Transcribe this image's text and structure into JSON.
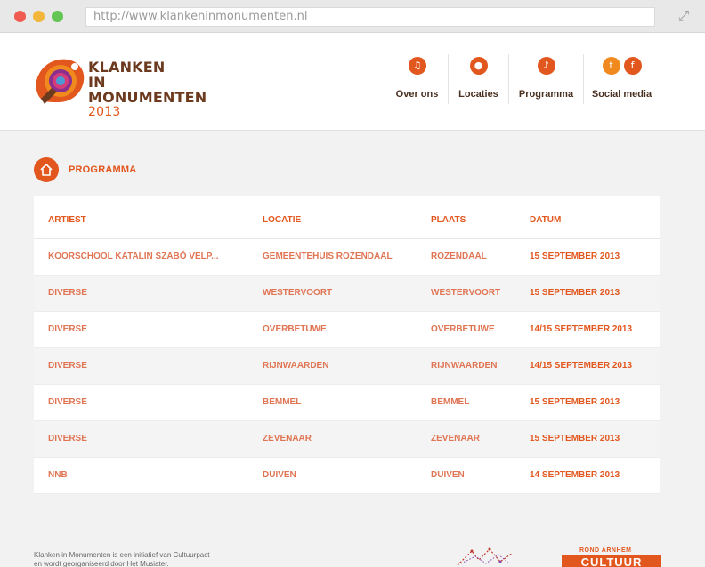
{
  "browser": {
    "url": "http://www.klankeninmonumenten.nl"
  },
  "logo": {
    "line1": "KLANKEN",
    "line2": "IN MONUMENTEN",
    "year": "2013"
  },
  "nav": {
    "items": [
      {
        "label": "Over ons",
        "icon": "music-note-icon"
      },
      {
        "label": "Locaties",
        "icon": "map-pin-icon"
      },
      {
        "label": "Programma",
        "icon": "guitar-icon"
      },
      {
        "label": "Social media",
        "icon": "twitter-facebook-icon"
      }
    ]
  },
  "section": {
    "title": "PROGRAMMA",
    "icon": "home-icon"
  },
  "table": {
    "headers": [
      "ARTIEST",
      "LOCATIE",
      "PLAATS",
      "DATUM"
    ],
    "rows": [
      [
        "KOORSCHOOL KATALIN SZABÓ VELP...",
        "GEMEENTEHUIS ROZENDAAL",
        "ROZENDAAL",
        "15 SEPTEMBER 2013"
      ],
      [
        "DIVERSE",
        "WESTERVOORT",
        "WESTERVOORT",
        "15 SEPTEMBER 2013"
      ],
      [
        "DIVERSE",
        "OVERBETUWE",
        "OVERBETUWE",
        "14/15 SEPTEMBER 2013"
      ],
      [
        "DIVERSE",
        "RIJNWAARDEN",
        "RIJNWAARDEN",
        "14/15 SEPTEMBER 2013"
      ],
      [
        "DIVERSE",
        "BEMMEL",
        "BEMMEL",
        "15 SEPTEMBER 2013"
      ],
      [
        "DIVERSE",
        "ZEVENAAR",
        "ZEVENAAR",
        "15 SEPTEMBER 2013"
      ],
      [
        "NNB",
        "DUIVEN",
        "DUIVEN",
        "14 SEPTEMBER 2013"
      ]
    ]
  },
  "footer": {
    "line1": "Klanken in Monumenten is een initiatief van Cultuurpact",
    "line2": "en wordt georganiseerd door Het Musiater.",
    "partner_top": "ROND ARNHEM",
    "partner_name": "CULTUUR"
  },
  "colors": {
    "accent": "#e2571e",
    "brown": "#6b3a1f"
  }
}
